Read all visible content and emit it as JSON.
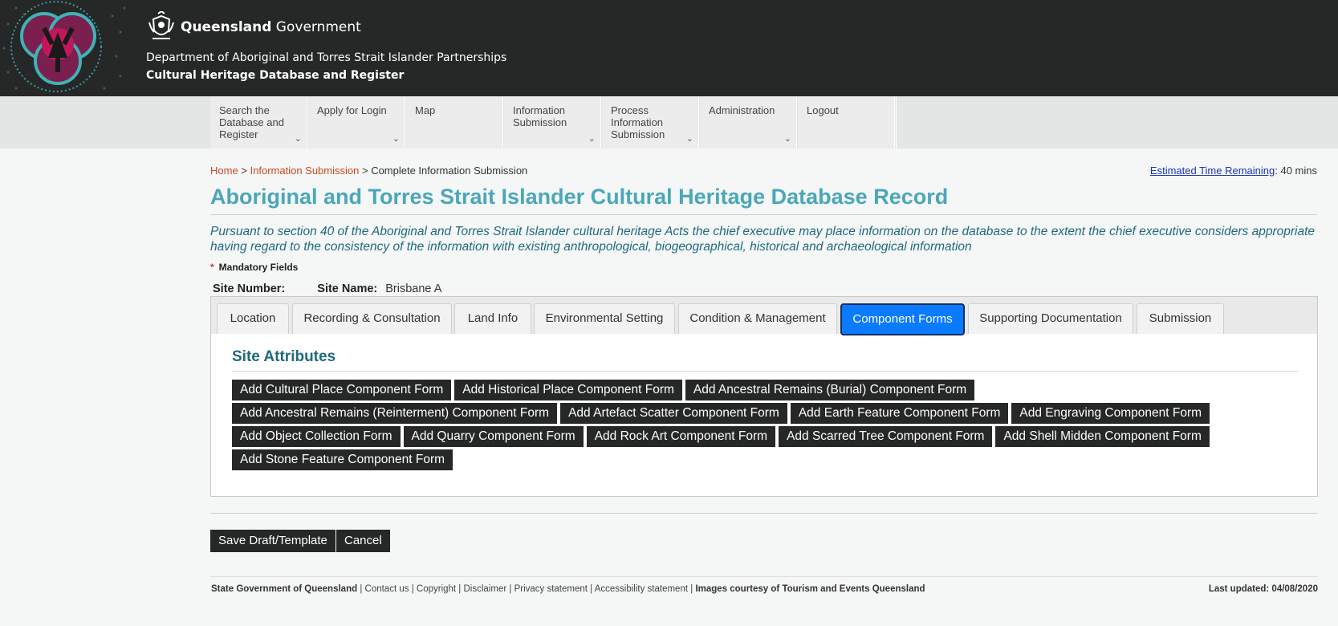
{
  "header": {
    "gov_bold": "Queensland",
    "gov_rest": " Government",
    "department": "Department of Aboriginal and Torres Strait Islander Partnerships",
    "subtitle": "Cultural Heritage Database and Register"
  },
  "nav": {
    "items": [
      {
        "label": "Search the Database and Register",
        "dropdown": true
      },
      {
        "label": "Apply for Login",
        "dropdown": true
      },
      {
        "label": "Map",
        "dropdown": false
      },
      {
        "label": "Information Submission",
        "dropdown": true
      },
      {
        "label": "Process Information Submission",
        "dropdown": true
      },
      {
        "label": "Administration",
        "dropdown": true
      },
      {
        "label": "Logout",
        "dropdown": false
      }
    ]
  },
  "breadcrumb": {
    "home": "Home",
    "sep": " > ",
    "section": "Information Submission",
    "current": "Complete Information Submission"
  },
  "timer": {
    "label": "Estimated Time Remaining",
    "value": ": 40 mins"
  },
  "page": {
    "title": "Aboriginal and Torres Strait Islander Cultural Heritage Database Record",
    "intro": "Pursuant to section 40 of the Aboriginal and Torres Strait Islander cultural heritage Acts the chief executive may place information on the database to the extent the chief executive considers appropriate having regard to the consistency of the information with existing anthropological, biogeographical, historical and archaeological information",
    "mandatory_star": "*",
    "mandatory_label": "Mandatory Fields",
    "site_number_label": "Site Number:",
    "site_name_label": "Site Name:",
    "site_name_value": "Brisbane A"
  },
  "tabs": [
    {
      "label": "Location"
    },
    {
      "label": "Recording & Consultation"
    },
    {
      "label": "Land Info"
    },
    {
      "label": "Environmental Setting"
    },
    {
      "label": "Condition & Management"
    },
    {
      "label": "Component Forms",
      "active": true
    },
    {
      "label": "Supporting Documentation"
    },
    {
      "label": "Submission"
    }
  ],
  "site_attributes": {
    "title": "Site Attributes",
    "buttons": [
      "Add Cultural Place Component Form",
      "Add Historical Place Component Form",
      "Add Ancestral Remains (Burial) Component Form",
      "Add Ancestral Remains (Reinterment) Component Form",
      "Add Artefact Scatter Component Form",
      "Add Earth Feature Component Form",
      "Add Engraving Component Form",
      "Add Object Collection Form",
      "Add Quarry Component Form",
      "Add Rock Art Component Form",
      "Add Scarred Tree Component Form",
      "Add Shell Midden Component Form",
      "Add Stone Feature Component Form"
    ]
  },
  "actions": {
    "save": "Save Draft/Template",
    "cancel": "Cancel"
  },
  "footer": {
    "owner": "State Government of Queensland",
    "contact": "Contact us",
    "copyright": "Copyright",
    "disclaimer": "Disclaimer",
    "privacy": "Privacy statement",
    "accessibility": "Accessibility statement",
    "images": "Images courtesy of Tourism and Events Queensland",
    "divider": " | ",
    "updated": "Last updated: 04/08/2020"
  },
  "colors": {
    "accent": "#4aa7b8",
    "link": "#c94a1f",
    "active_tab": "#0a7bff",
    "header_bg": "#262727"
  },
  "icons": {
    "logo": "aboriginal-art-logo",
    "crest": "queensland-crest",
    "dropdown": "chevron-down-icon"
  }
}
